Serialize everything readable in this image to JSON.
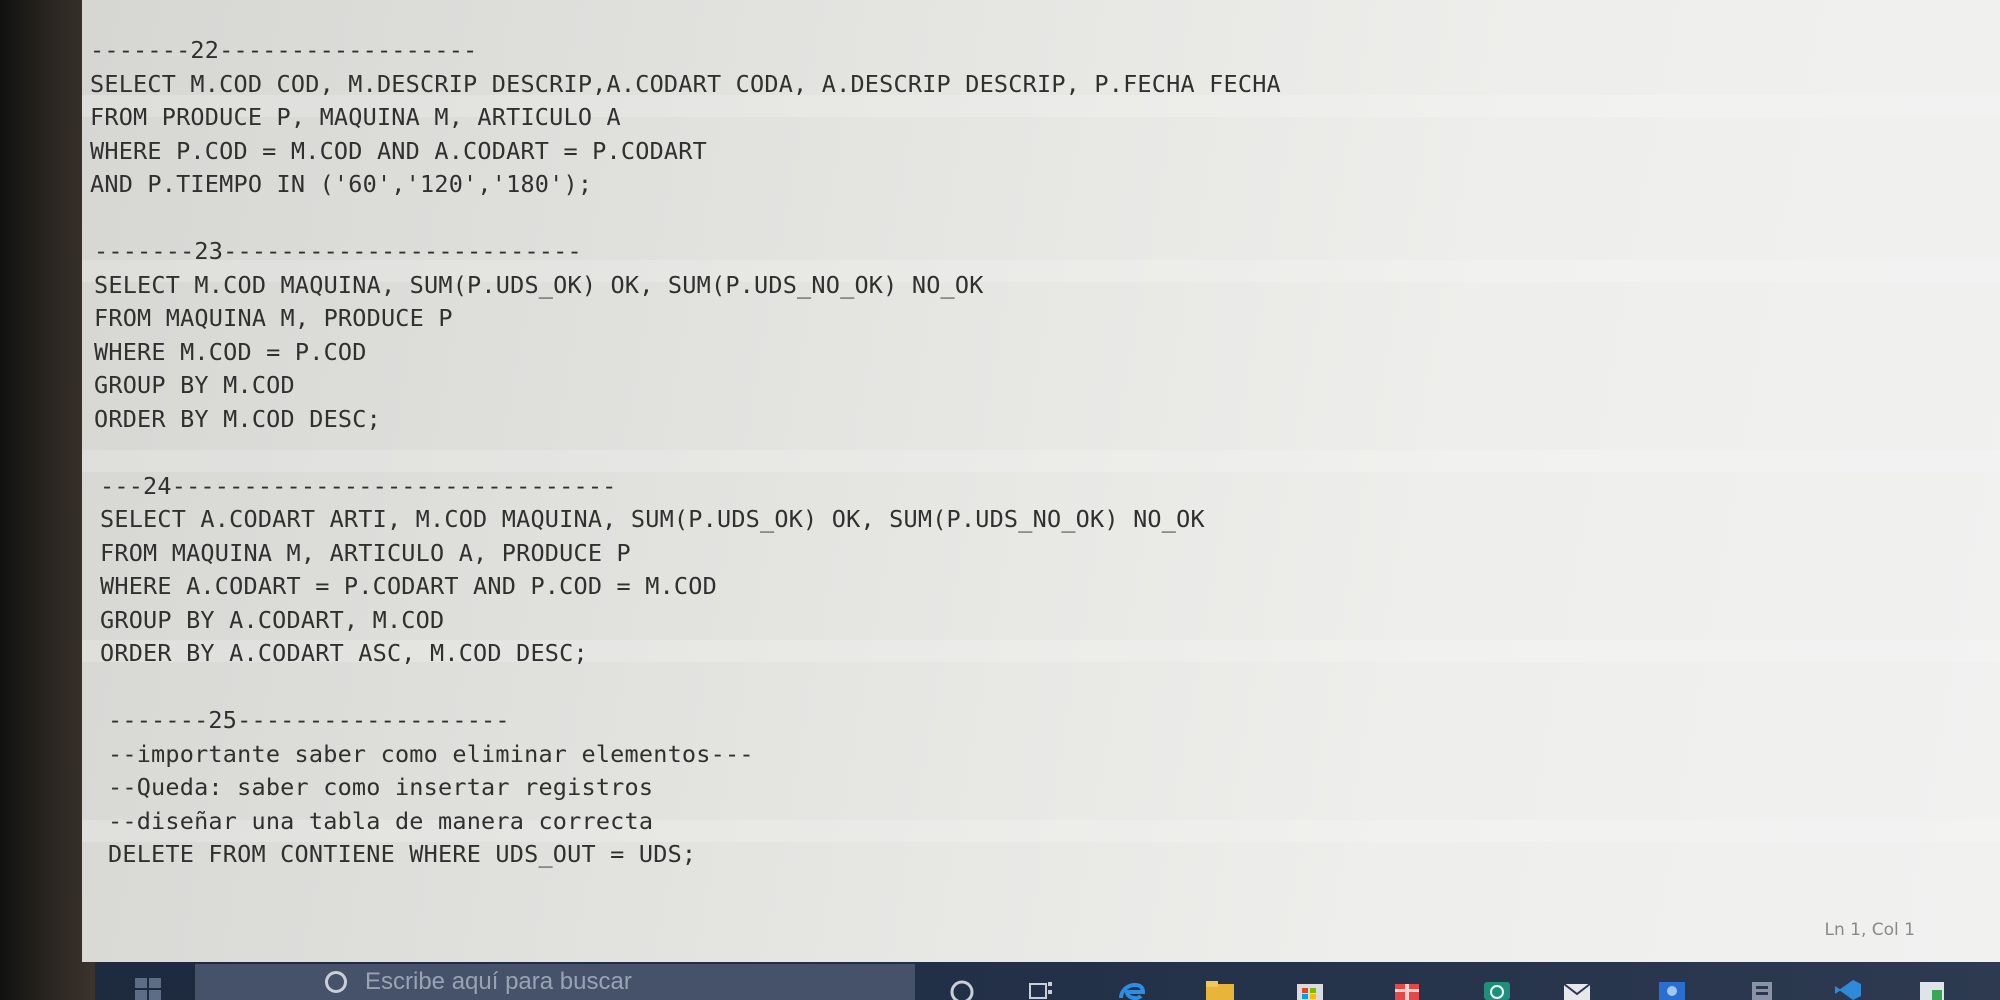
{
  "editor": {
    "lines_22": [
      "-------22------------------",
      "SELECT M.COD COD, M.DESCRIP DESCRIP,A.CODART CODA, A.DESCRIP DESCRIP, P.FECHA FECHA",
      "FROM PRODUCE P, MAQUINA M, ARTICULO A",
      "WHERE P.COD = M.COD AND A.CODART = P.CODART",
      "AND P.TIEMPO IN ('60','120','180');"
    ],
    "lines_23": [
      "-------23-------------------------",
      "SELECT M.COD MAQUINA, SUM(P.UDS_OK) OK, SUM(P.UDS_NO_OK) NO_OK",
      "FROM MAQUINA M, PRODUCE P",
      "WHERE M.COD = P.COD",
      "GROUP BY M.COD",
      "ORDER BY M.COD DESC;"
    ],
    "lines_24": [
      "---24-------------------------------",
      "SELECT A.CODART ARTI, M.COD MAQUINA, SUM(P.UDS_OK) OK, SUM(P.UDS_NO_OK) NO_OK",
      "FROM MAQUINA M, ARTICULO A, PRODUCE P",
      "WHERE A.CODART = P.CODART AND P.COD = M.COD",
      "GROUP BY A.CODART, M.COD",
      "ORDER BY A.CODART ASC, M.COD DESC;"
    ],
    "lines_25": [
      "-------25-------------------",
      "--importante saber como eliminar elementos---",
      "--Queda: saber como insertar registros",
      "--diseñar una tabla de manera correcta",
      "DELETE FROM CONTIENE WHERE UDS_OUT = UDS;"
    ]
  },
  "status_bar": {
    "position": "Ln 1, Col 1"
  },
  "taskbar": {
    "search_placeholder": "Escribe aquí para buscar",
    "icons": [
      "windows-start-icon",
      "search-icon",
      "task-view-icon",
      "edge-icon",
      "file-explorer-icon",
      "store-icon",
      "gift-icon",
      "whatsapp-icon",
      "mail-icon",
      "app-icon",
      "app-icon",
      "vscode-icon",
      "app-icon",
      "app-icon"
    ]
  }
}
